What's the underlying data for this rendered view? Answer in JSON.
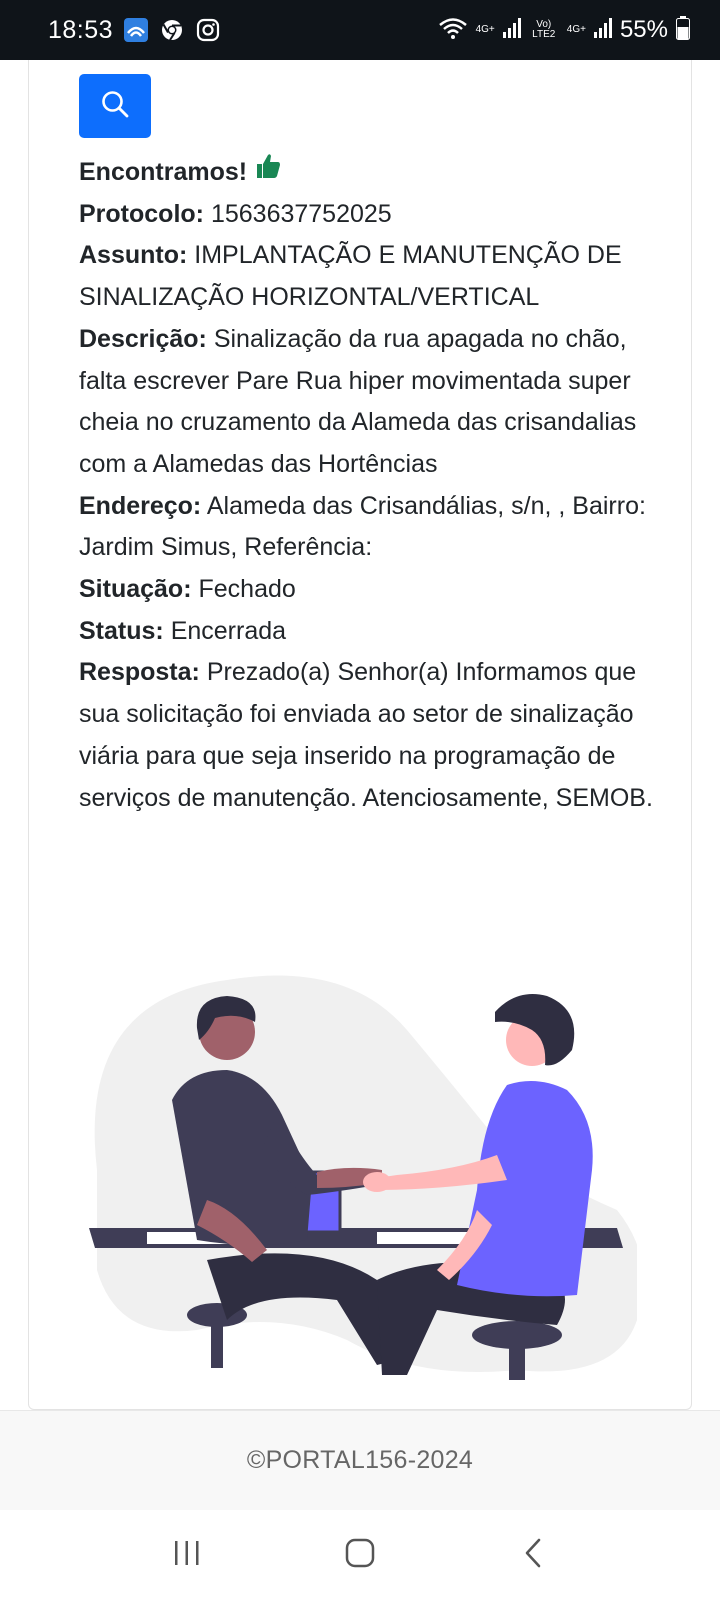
{
  "status_bar": {
    "time": "18:53",
    "network_a": "4G+",
    "volte": "Vo) LTE2",
    "network_b": "4G+",
    "battery": "55%"
  },
  "result": {
    "found_label": "Encontramos!",
    "protocol_label": "Protocolo:",
    "protocol_value": "1563637752025",
    "subject_label": "Assunto:",
    "subject_value": "IMPLANTAÇÃO E MANUTENÇÃO DE SINALIZAÇÃO HORIZONTAL/VERTICAL",
    "description_label": "Descrição:",
    "description_value": "Sinalização da rua apagada no chão, falta escrever Pare Rua hiper movimentada super cheia no cruzamento da Alameda das crisandalias com a Alamedas das Hortências",
    "address_label": "Endereço:",
    "address_value": "Alameda das Crisandálias, s/n, , Bairro: Jardim Simus, Referência:",
    "situation_label": "Situação:",
    "situation_value": "Fechado",
    "status_label": "Status:",
    "status_value": "Encerrada",
    "response_label": "Resposta:",
    "response_value": "Prezado(a) Senhor(a) Informamos que sua solicitação foi enviada ao setor de sinalização viária para que seja inserido na programação de serviços de manutenção. Atenciosamente, SEMOB."
  },
  "footer": {
    "copyright": "©PORTAL156-2024"
  },
  "colors": {
    "primary": "#0d6efd",
    "thumb": "#198754",
    "illus_purple": "#6c63ff",
    "illus_dark": "#3f3d56",
    "illus_skin_light": "#ffb8b8",
    "illus_skin_dark": "#a0616a"
  }
}
